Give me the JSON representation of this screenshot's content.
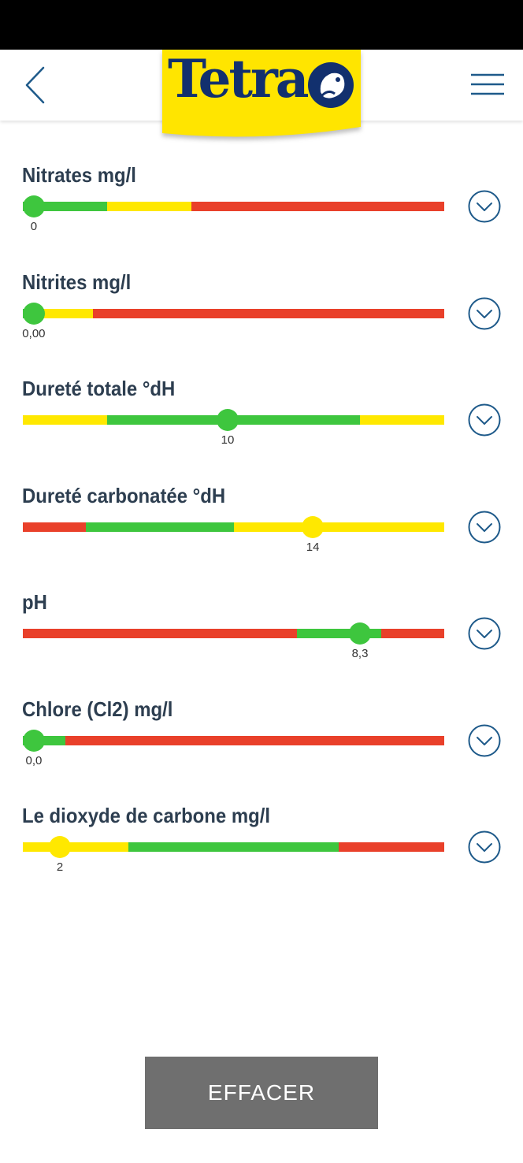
{
  "header": {
    "logo_text": "Tetra"
  },
  "colors": {
    "green": "#3ec63e",
    "yellow": "#ffe800",
    "red": "#e9402a",
    "accent": "#1e5a8a",
    "button": "#6f6f6f"
  },
  "parameters": [
    {
      "title": "Nitrates mg/l",
      "value_label": "0",
      "position": 0.026,
      "thumb_color": "green",
      "segments": [
        {
          "color": "green",
          "fraction": 0.2
        },
        {
          "color": "yellow",
          "fraction": 0.2
        },
        {
          "color": "red",
          "fraction": 0.6
        }
      ]
    },
    {
      "title": "Nitrites mg/l",
      "value_label": "0,00",
      "position": 0.026,
      "thumb_color": "green",
      "segments": [
        {
          "color": "green",
          "fraction": 0.03
        },
        {
          "color": "yellow",
          "fraction": 0.137
        },
        {
          "color": "red",
          "fraction": 0.833
        }
      ]
    },
    {
      "title": "Dureté totale °dH",
      "value_label": "10",
      "position": 0.486,
      "thumb_color": "green",
      "segments": [
        {
          "color": "yellow",
          "fraction": 0.2
        },
        {
          "color": "green",
          "fraction": 0.6
        },
        {
          "color": "yellow",
          "fraction": 0.2
        }
      ]
    },
    {
      "title": "Dureté carbonatée °dH",
      "value_label": "14",
      "position": 0.688,
      "thumb_color": "yellow",
      "segments": [
        {
          "color": "red",
          "fraction": 0.15
        },
        {
          "color": "green",
          "fraction": 0.35
        },
        {
          "color": "yellow",
          "fraction": 0.5
        }
      ]
    },
    {
      "title": "pH",
      "value_label": "8,3",
      "position": 0.8,
      "thumb_color": "green",
      "segments": [
        {
          "color": "red",
          "fraction": 0.65
        },
        {
          "color": "green",
          "fraction": 0.2
        },
        {
          "color": "red",
          "fraction": 0.15
        }
      ]
    },
    {
      "title": "Chlore (Cl2) mg/l",
      "value_label": "0,0",
      "position": 0.026,
      "thumb_color": "green",
      "segments": [
        {
          "color": "green",
          "fraction": 0.1
        },
        {
          "color": "red",
          "fraction": 0.9
        }
      ]
    },
    {
      "title": "Le dioxyde de carbone mg/l",
      "value_label": "2",
      "position": 0.088,
      "thumb_color": "yellow",
      "segments": [
        {
          "color": "yellow",
          "fraction": 0.25
        },
        {
          "color": "green",
          "fraction": 0.5
        },
        {
          "color": "red",
          "fraction": 0.25
        }
      ]
    }
  ],
  "footer": {
    "clear_label": "EFFACER"
  }
}
